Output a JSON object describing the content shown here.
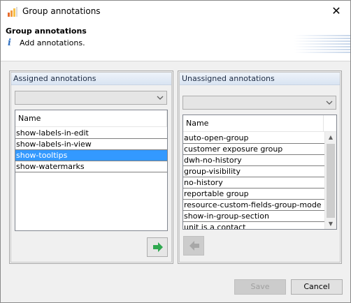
{
  "window": {
    "title": "Group annotations",
    "close_glyph": "✕"
  },
  "header": {
    "title": "Group annotations",
    "message": "Add annotations."
  },
  "assigned": {
    "title": "Assigned annotations",
    "filter_value": "",
    "column": "Name",
    "items": [
      "show-labels-in-edit",
      "show-labels-in-view",
      "show-tooltips",
      "show-watermarks"
    ],
    "selected_index": 2
  },
  "unassigned": {
    "title": "Unassigned annotations",
    "filter_value": "",
    "column": "Name",
    "items": [
      "auto-open-group",
      "customer exposure group",
      "dwh-no-history",
      "group-visibility",
      "no-history",
      "reportable group",
      "resource-custom-fields-group-mode",
      "show-in-group-section",
      "unit is a contact"
    ]
  },
  "buttons": {
    "save": "Save",
    "cancel": "Cancel"
  },
  "colors": {
    "selection": "#3399ff",
    "add_arrow": "#2fa84f",
    "disabled_arrow": "#a7a7a7"
  }
}
